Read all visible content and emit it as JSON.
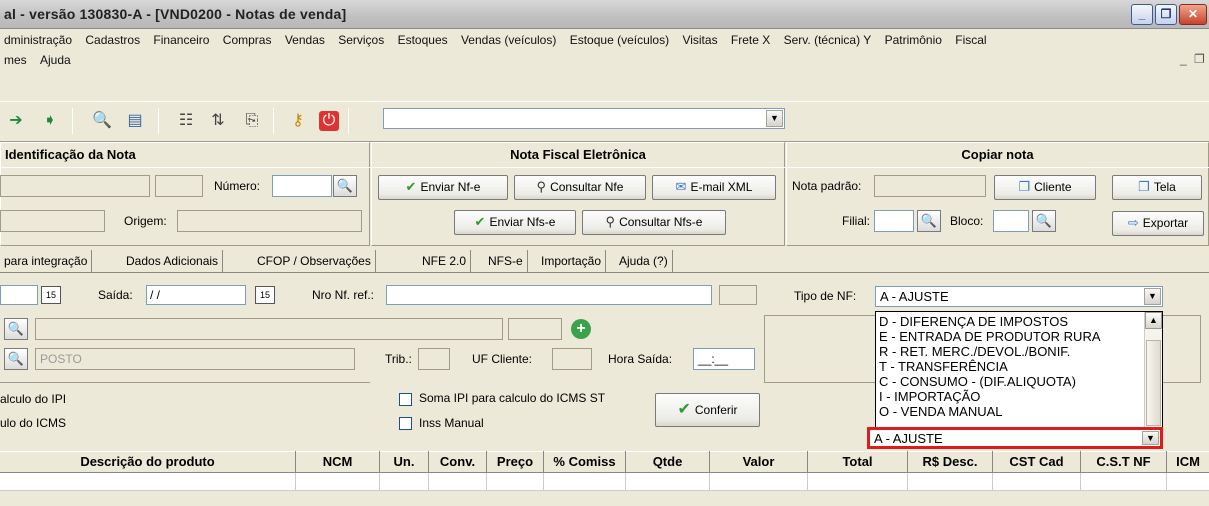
{
  "window": {
    "title": "al - versão 130830-A - [VND0200 - Notas de venda]",
    "minimize": "_",
    "restore": "❐",
    "close": "✕"
  },
  "menu": {
    "row1": [
      "dministração",
      "Cadastros",
      "Financeiro",
      "Compras",
      "Vendas",
      "Serviços",
      "Estoques",
      "Vendas (veículos)",
      "Estoque (veículos)",
      "Visitas",
      "Frete X",
      "Serv. (técnica) Y",
      "Patrimônio",
      "Fiscal"
    ],
    "row2": [
      "mes",
      "Ajuda"
    ],
    "mdi_min": "_",
    "mdi_restore": "❐"
  },
  "sections": {
    "identificacao": "Identificação da Nota",
    "nfe": "Nota Fiscal Eletrônica",
    "copiar": "Copiar nota"
  },
  "ident": {
    "numero_label": "Número:",
    "origem_label": "Origem:"
  },
  "nfe_buttons": {
    "enviar_nfe": "Enviar Nf-e",
    "consultar_nfe": "Consultar Nfe",
    "email_xml": "E-mail XML",
    "enviar_nfse": "Enviar Nfs-e",
    "consultar_nfse": "Consultar Nfs-e"
  },
  "copiar": {
    "nota_padrao_label": "Nota padrão:",
    "filial_label": "Filial:",
    "bloco_label": "Bloco:",
    "cliente": "Cliente",
    "tela": "Tela",
    "exportar": "Exportar"
  },
  "tabs": [
    "para integração",
    "Dados Adicionais",
    "CFOP / Observações",
    "NFE 2.0",
    "NFS-e",
    "Importação",
    "Ajuda (?)"
  ],
  "form": {
    "saida_label": "Saída:",
    "saida_value": " / /",
    "nro_ref_label": "Nro Nf. ref.:",
    "tipo_nf_label": "Tipo de NF:",
    "tipo_nf_value": "A - AJUSTE",
    "posto_value": "POSTO",
    "trib_label": "Trib.:",
    "uf_label": "UF Cliente:",
    "hora_label": "Hora Saída:",
    "hora_value": "__:__",
    "calc_ipi": "alculo do IPI",
    "calc_icms": "ulo do ICMS",
    "soma_ipi": "Soma IPI para calculo do ICMS ST",
    "inss_manual": "Inss Manual",
    "conferir": "Conferir"
  },
  "dropdown": {
    "options": [
      "D - DIFERENÇA DE IMPOSTOS",
      "E - ENTRADA DE PRODUTOR RURA",
      "R - RET. MERC./DEVOL./BONIF.",
      "T - TRANSFERÊNCIA",
      "C - CONSUMO - (DIF.ALIQUOTA)",
      "I - IMPORTAÇÃO",
      "O - VENDA MANUAL"
    ],
    "selected": "A - AJUSTE"
  },
  "grid": {
    "columns": [
      "Descrição do produto",
      "NCM",
      "Un.",
      "Conv.",
      "Preço",
      "% Comiss",
      "Qtde",
      "Valor",
      "Total",
      "R$ Desc.",
      "CST Cad",
      "C.S.T NF",
      "ICM"
    ]
  }
}
